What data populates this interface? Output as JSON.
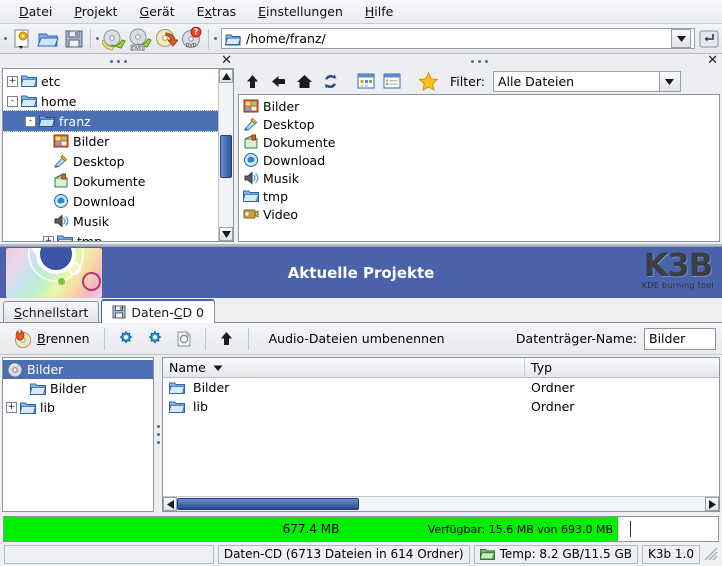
{
  "menubar": {
    "items": [
      {
        "label": "Datei",
        "accel": "D"
      },
      {
        "label": "Projekt",
        "accel": "P"
      },
      {
        "label": "Gerät",
        "accel": "G"
      },
      {
        "label": "Extras",
        "accel": "x"
      },
      {
        "label": "Einstellungen",
        "accel": "E"
      },
      {
        "label": "Hilfe",
        "accel": "H"
      }
    ]
  },
  "toolbar": {
    "buttons": [
      {
        "name": "new-project-icon",
        "title": "Neues Projekt"
      },
      {
        "name": "open-folder-icon",
        "title": "Öffnen"
      },
      {
        "name": "save-icon",
        "title": "Speichern"
      },
      {
        "name": "copy-cd-icon",
        "title": "CD kopieren"
      },
      {
        "name": "copy-dvd-icon",
        "title": "DVD kopieren"
      },
      {
        "name": "erase-cdrw-icon",
        "title": "CD-RW löschen"
      },
      {
        "name": "format-dvd-icon",
        "title": "DVD formatieren"
      }
    ],
    "path_value": "/home/franz/",
    "path_placeholder": "/home/franz/"
  },
  "browser": {
    "tree": {
      "items": [
        {
          "label": "etc",
          "icon": "folder-icon",
          "expander": "+",
          "indent": 0,
          "selected": false
        },
        {
          "label": "home",
          "icon": "folder-icon",
          "expander": "-",
          "indent": 0,
          "selected": false
        },
        {
          "label": "franz",
          "icon": "folder-open-icon",
          "expander": "-",
          "indent": 1,
          "selected": true
        },
        {
          "label": "Bilder",
          "icon": "pictures-icon",
          "expander": "",
          "indent": 2,
          "selected": false
        },
        {
          "label": "Desktop",
          "icon": "desktop-icon",
          "expander": "",
          "indent": 2,
          "selected": false
        },
        {
          "label": "Dokumente",
          "icon": "documents-icon",
          "expander": "",
          "indent": 2,
          "selected": false
        },
        {
          "label": "Download",
          "icon": "download-icon",
          "expander": "",
          "indent": 2,
          "selected": false
        },
        {
          "label": "Musik",
          "icon": "music-icon",
          "expander": "",
          "indent": 2,
          "selected": false
        },
        {
          "label": "tmp",
          "icon": "folder-icon",
          "expander": "+",
          "indent": 2,
          "selected": false
        }
      ]
    },
    "filetools": {
      "buttons": [
        {
          "name": "up-arrow-icon",
          "title": "Aufwärts"
        },
        {
          "name": "back-arrow-icon",
          "title": "Zurück"
        },
        {
          "name": "home-icon",
          "title": "Persönlicher Ordner"
        },
        {
          "name": "reload-icon",
          "title": "Erneut laden"
        },
        {
          "name": "icon-view-icon",
          "title": "Symbolansicht"
        },
        {
          "name": "detail-view-icon",
          "title": "Detailansicht"
        },
        {
          "name": "bookmark-star-icon",
          "title": "Lesezeichen"
        }
      ],
      "filter_label": "Filter:",
      "filter_value": "Alle Dateien"
    },
    "files": [
      {
        "label": "Bilder",
        "icon": "pictures-icon"
      },
      {
        "label": "Desktop",
        "icon": "desktop-icon"
      },
      {
        "label": "Dokumente",
        "icon": "documents-icon"
      },
      {
        "label": "Download",
        "icon": "download-icon"
      },
      {
        "label": "Musik",
        "icon": "music-icon"
      },
      {
        "label": "tmp",
        "icon": "folder-icon"
      },
      {
        "label": "Video",
        "icon": "video-icon"
      }
    ],
    "close_label": "✕"
  },
  "banner": {
    "title": "Aktuelle Projekte",
    "logo": "K3B",
    "logo_sub": "KDE burning tool",
    "bg_color": "#4a62ab"
  },
  "tabs": [
    {
      "label": "Schnellstart",
      "active": false,
      "icon": ""
    },
    {
      "label": "Daten-CD 0",
      "active": true,
      "icon": "floppy-save-icon"
    }
  ],
  "project_toolbar": {
    "burn_label": "Brennen",
    "buttons": [
      {
        "name": "project-properties-icon",
        "title": "Projekt-Eigenschaften"
      },
      {
        "name": "settings-gear-icon",
        "title": "Einstellungen"
      },
      {
        "name": "new-document-icon",
        "title": "Neues Dokument"
      },
      {
        "name": "parent-folder-icon",
        "title": "Übergeordneter Ordner"
      }
    ],
    "rename_label": "Audio-Dateien umbenennen",
    "volume_label": "Datenträger-Name:",
    "volume_value": "Bilder"
  },
  "project": {
    "tree": [
      {
        "label": "Bilder",
        "icon": "cd-disc-icon",
        "expander": "",
        "indent": 0,
        "selected": true
      },
      {
        "label": "Bilder",
        "icon": "folder-icon",
        "expander": "",
        "indent": 1,
        "selected": false
      },
      {
        "label": "lib",
        "icon": "folder-icon",
        "expander": "+",
        "indent": 0,
        "selected": false
      }
    ],
    "columns": [
      "Name",
      "Typ"
    ],
    "rows": [
      {
        "name": "Bilder",
        "typ": "Ordner",
        "icon": "folder-icon"
      },
      {
        "name": "lib",
        "typ": "Ordner",
        "icon": "folder-icon"
      }
    ]
  },
  "capacity": {
    "used_label": "677.4 MB",
    "available_label": "Verfügbar: 15.6 MB von 693.0 MB",
    "fill_percent": 86,
    "fill_color": "#00ee00"
  },
  "statusbar": {
    "project_info": "Daten-CD (6713 Dateien in 614 Ordner)",
    "temp_info": "Temp: 8.2 GB/11.5 GB",
    "version": "K3b 1.0"
  }
}
